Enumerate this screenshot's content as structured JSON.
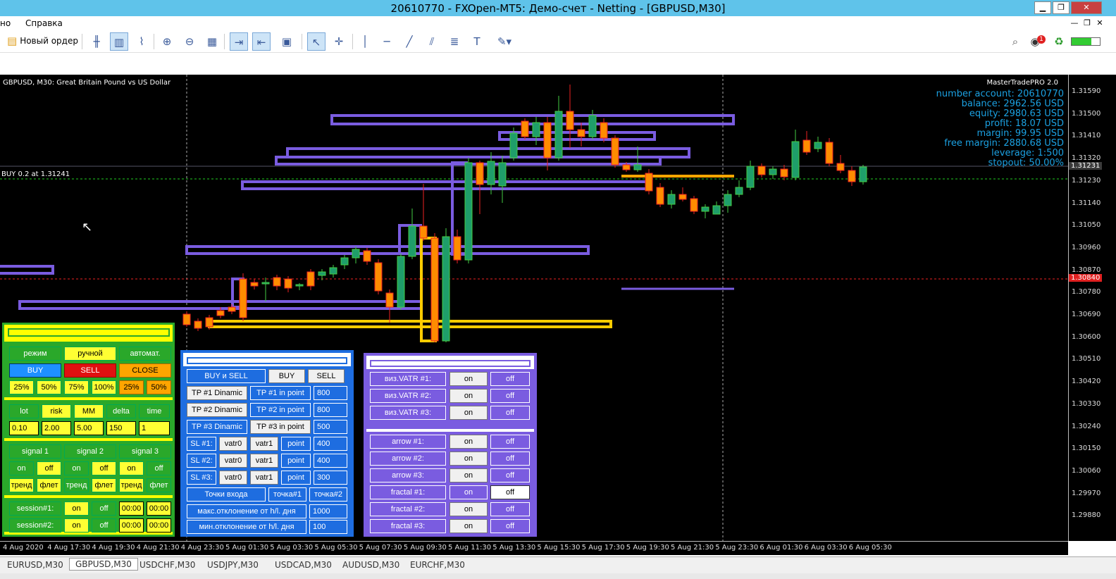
{
  "window": {
    "title": "20610770 - FXOpen-MT5: Демо-счет - Netting - [GBPUSD,M30]"
  },
  "menu": {
    "item1": "но",
    "item2": "Справка"
  },
  "toolbar": {
    "new_order": "Новый ордер"
  },
  "chart": {
    "header": "GBPUSD, M30:  Great Britain Pound vs US Dollar",
    "indicator_name": "MasterTradePRO 2.0",
    "position_label": "BUY 0.2 at 1.31241",
    "current_price": "1.31231",
    "red_price": "1.30840"
  },
  "account": {
    "number": "number account: 20610770",
    "balance": "balance: 2962.56 USD",
    "equity": "equity: 2980.63 USD",
    "profit": "profit: 18.07 USD",
    "margin": "margin: 99.95 USD",
    "free_margin": "free margin: 2880.68 USD",
    "leverage": "leverage: 1:500",
    "stopout": "stopout: 50.00%"
  },
  "price_scale": [
    "1.31590",
    "1.31500",
    "1.31410",
    "1.31320",
    "1.31230",
    "1.31140",
    "1.31050",
    "1.30960",
    "1.30870",
    "1.30780",
    "1.30690",
    "1.30600",
    "1.30510",
    "1.30420",
    "1.30330",
    "1.30240",
    "1.30150",
    "1.30060",
    "1.29970",
    "1.29880"
  ],
  "time_scale": [
    "4 Aug 2020",
    "4 Aug 17:30",
    "4 Aug 19:30",
    "4 Aug 21:30",
    "4 Aug 23:30",
    "5 Aug 01:30",
    "5 Aug 03:30",
    "5 Aug 05:30",
    "5 Aug 07:30",
    "5 Aug 09:30",
    "5 Aug 11:30",
    "5 Aug 13:30",
    "5 Aug 15:30",
    "5 Aug 17:30",
    "5 Aug 19:30",
    "5 Aug 21:30",
    "5 Aug 23:30",
    "6 Aug 01:30",
    "6 Aug 03:30",
    "6 Aug 05:30"
  ],
  "symbol_tabs": [
    "EURUSD,M30",
    "GBPUSD,M30",
    "USDCHF,M30",
    "USDJPY,M30",
    "USDCAD,M30",
    "AUDUSD,M30",
    "EURCHF,M30"
  ],
  "panel_green": {
    "mode": "режим",
    "manual": "ручной",
    "auto": "автомат.",
    "buy": "BUY",
    "sell": "SELL",
    "close": "CLOSE",
    "p25": "25%",
    "p50": "50%",
    "p75": "75%",
    "p100": "100%",
    "c25": "25%",
    "c50": "50%",
    "lot": "lot",
    "risk": "risk",
    "mm": "MM",
    "delta": "delta",
    "time": "time",
    "lot_val": "0.10",
    "risk_val": "2.00",
    "mm_val": "5.00",
    "delta_val": "150",
    "time_val": "1",
    "signal1": "signal 1",
    "signal2": "signal 2",
    "signal3": "signal 3",
    "on": "on",
    "off": "off",
    "trend": "тренд",
    "flat": "флет",
    "session1": "session#1:",
    "session2": "session#2:",
    "t0000": "00:00"
  },
  "panel_blue": {
    "buy_sell": "BUY и SELL",
    "buy": "BUY",
    "sell": "SELL",
    "tp1d": "TP #1 Dinamic",
    "tp1p": "TP #1 in point",
    "tp1v": "800",
    "tp2d": "TP #2 Dinamic",
    "tp2p": "TP #2 in point",
    "tp2v": "800",
    "tp3d": "TP #3 Dinamic",
    "tp3p": "TP #3 in point",
    "tp3v": "500",
    "sl1": "SL #1:",
    "sl2": "SL #2:",
    "sl3": "SL #3:",
    "vatr0": "vatr0",
    "vatr1": "vatr1",
    "point": "point",
    "sl1v": "400",
    "sl2v": "400",
    "sl3v": "300",
    "entry": "Точки входа",
    "e1": "точка#1",
    "e2": "точка#2",
    "maxdev": "макс.отклонение от h/l. дня",
    "maxdev_v": "1000",
    "mindev": "мин.отклонение от h/l. дня",
    "mindev_v": "100"
  },
  "panel_purple": {
    "v1": "виз.VATR #1:",
    "v2": "виз.VATR #2:",
    "v3": "виз.VATR #3:",
    "a1": "arrow #1:",
    "a2": "arrow #2:",
    "a3": "arrow #3:",
    "f1": "fractal #1:",
    "f2": "fractal #2:",
    "f3": "fractal #3:",
    "on": "on",
    "off": "off"
  }
}
